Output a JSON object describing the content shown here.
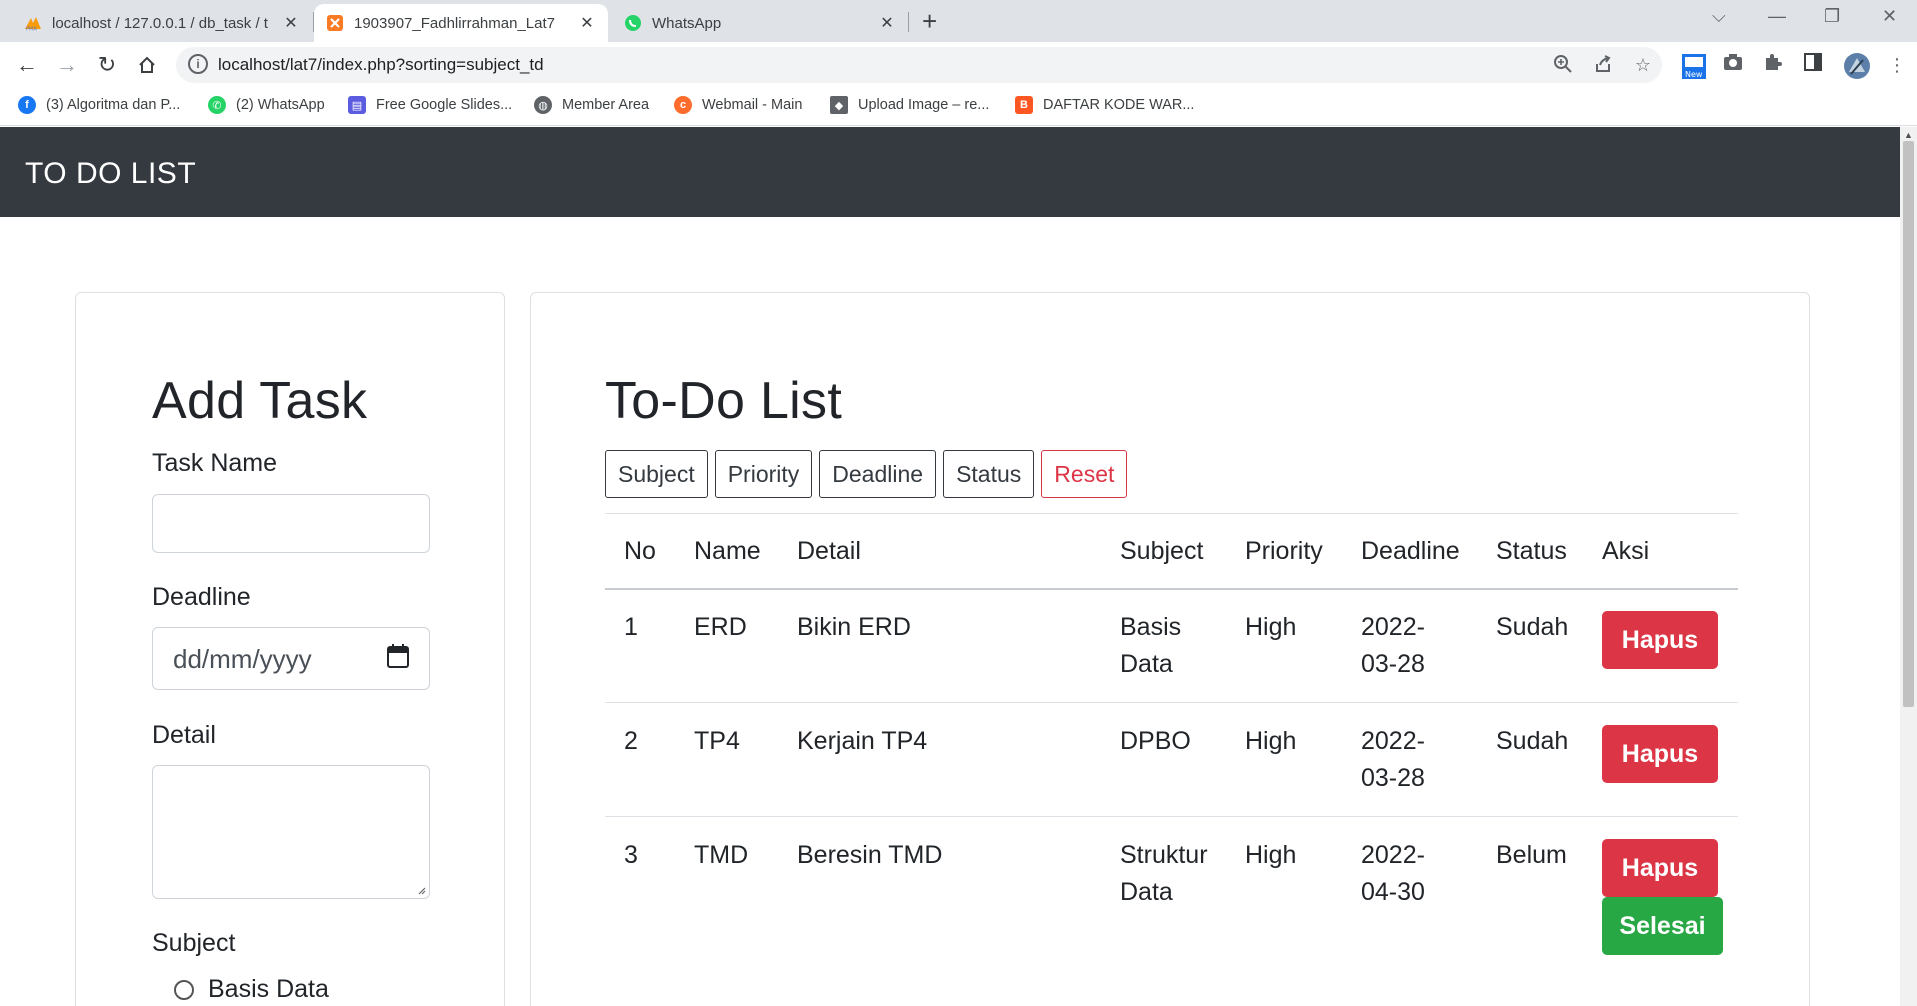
{
  "browser": {
    "tabs": [
      {
        "title": "localhost / 127.0.0.1 / db_task / t",
        "icon": "phpmyadmin-icon"
      },
      {
        "title": "1903907_Fadhlirrahman_Lat7",
        "icon": "xampp-icon"
      },
      {
        "title": "WhatsApp",
        "icon": "whatsapp-icon"
      }
    ],
    "url": "localhost/lat7/index.php?sorting=subject_td",
    "new_badge": "New",
    "bookmarks": [
      {
        "label": "(3) Algoritma dan P...",
        "icon": "facebook-icon",
        "color": "#1877f2"
      },
      {
        "label": "(2) WhatsApp",
        "icon": "whatsapp-icon",
        "color": "#25d366"
      },
      {
        "label": "Free Google Slides...",
        "icon": "slides-icon",
        "color": "#5c5ce0"
      },
      {
        "label": "Member Area",
        "icon": "globe-icon",
        "color": "#5f6368"
      },
      {
        "label": "Webmail - Main",
        "icon": "cpanel-icon",
        "color": "#ff6c2c"
      },
      {
        "label": "Upload Image – re...",
        "icon": "layers-icon",
        "color": "#5f6368"
      },
      {
        "label": "DAFTAR KODE WAR...",
        "icon": "blogger-icon",
        "color": "#ff5722"
      }
    ]
  },
  "navbar": {
    "brand": "TO DO LIST"
  },
  "add_task": {
    "title": "Add Task",
    "task_name_label": "Task Name",
    "task_name_value": "",
    "deadline_label": "Deadline",
    "deadline_placeholder": "dd/mm/yyyy",
    "detail_label": "Detail",
    "detail_value": "",
    "subject_label": "Subject",
    "subject_options": [
      "Basis Data"
    ]
  },
  "todo": {
    "title": "To-Do List",
    "sort_buttons": [
      "Subject",
      "Priority",
      "Deadline",
      "Status"
    ],
    "reset_label": "Reset",
    "headers": {
      "no": "No",
      "name": "Name",
      "detail": "Detail",
      "subject": "Subject",
      "priority": "Priority",
      "deadline": "Deadline",
      "status": "Status",
      "aksi": "Aksi"
    },
    "rows": [
      {
        "no": "1",
        "name": "ERD",
        "detail": "Bikin ERD",
        "subject_1": "Basis",
        "subject_2": "Data",
        "priority": "High",
        "deadline_1": "2022-",
        "deadline_2": "03-28",
        "status": "Sudah",
        "delete_label": "Hapus"
      },
      {
        "no": "2",
        "name": "TP4",
        "detail": "Kerjain TP4",
        "subject_1": "DPBO",
        "subject_2": "",
        "priority": "High",
        "deadline_1": "2022-",
        "deadline_2": "03-28",
        "status": "Sudah",
        "delete_label": "Hapus"
      },
      {
        "no": "3",
        "name": "TMD",
        "detail": "Beresin TMD",
        "subject_1": "Struktur",
        "subject_2": "Data",
        "priority": "High",
        "deadline_1": "2022-",
        "deadline_2": "04-30",
        "status": "Belum",
        "delete_label": "Hapus",
        "done_label": "Selesai"
      }
    ]
  },
  "colors": {
    "navbar": "#343a40",
    "danger": "#dc3545",
    "success": "#28a745"
  }
}
